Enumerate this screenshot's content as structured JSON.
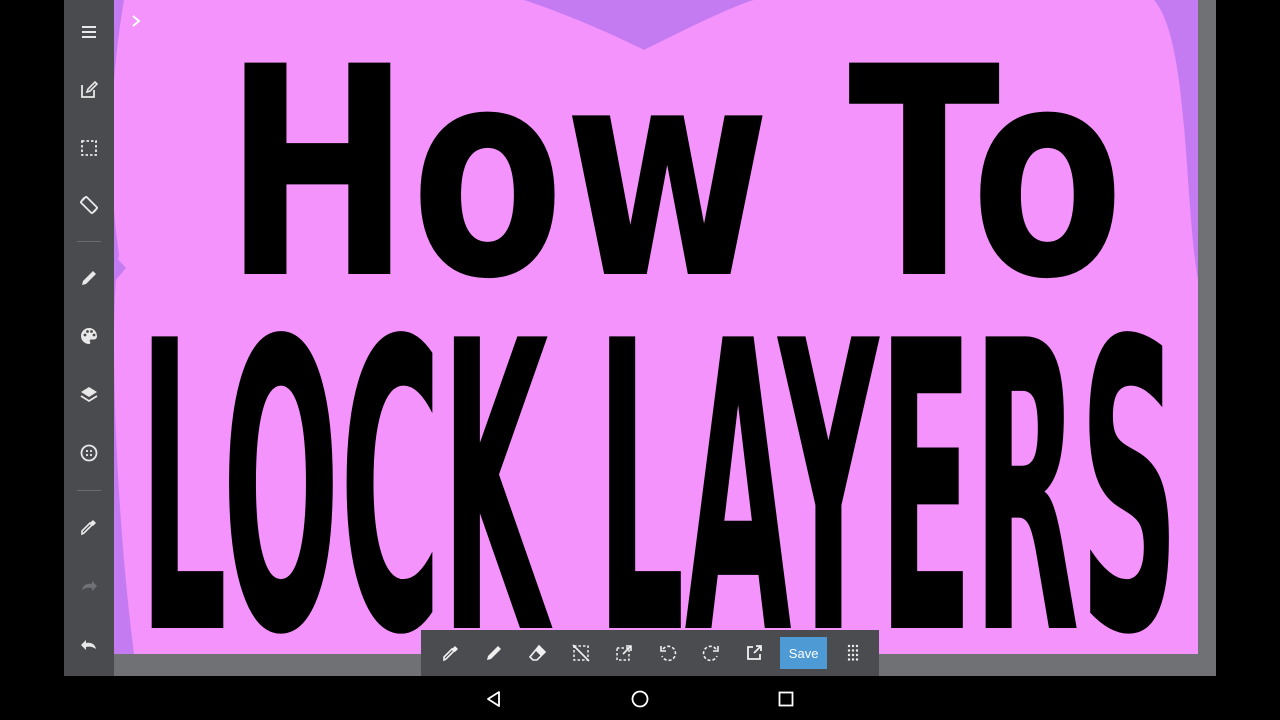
{
  "sidebar": {
    "items": [
      {
        "icon": "menu-icon",
        "enabled": true
      },
      {
        "icon": "edit-canvas-icon",
        "enabled": true
      },
      {
        "icon": "selection-icon",
        "enabled": true
      },
      {
        "icon": "rotate-screen-icon",
        "enabled": true
      },
      {
        "icon": "pen-icon",
        "enabled": true
      },
      {
        "icon": "palette-icon",
        "enabled": true
      },
      {
        "icon": "layers-icon",
        "enabled": true
      },
      {
        "icon": "material-icon",
        "enabled": true
      },
      {
        "icon": "eyedropper-icon",
        "enabled": true
      },
      {
        "icon": "redo-icon",
        "enabled": false
      },
      {
        "icon": "undo-icon",
        "enabled": true
      }
    ]
  },
  "canvas": {
    "line1": "How To",
    "line2": "LOCK LAYERS",
    "colors": {
      "background": "#c47bf2",
      "blob": "#f393fb",
      "ink": "#000000"
    }
  },
  "toolbar": {
    "tools": [
      "eyedropper-icon",
      "pen-icon",
      "eraser-icon",
      "deselect-icon",
      "transform-icon",
      "undo-icon",
      "redo-icon",
      "open-external-icon"
    ],
    "save_label": "Save",
    "more_icon": "grid-dots-icon"
  },
  "navbar": {
    "items": [
      "back-icon",
      "home-icon",
      "recents-icon"
    ]
  }
}
